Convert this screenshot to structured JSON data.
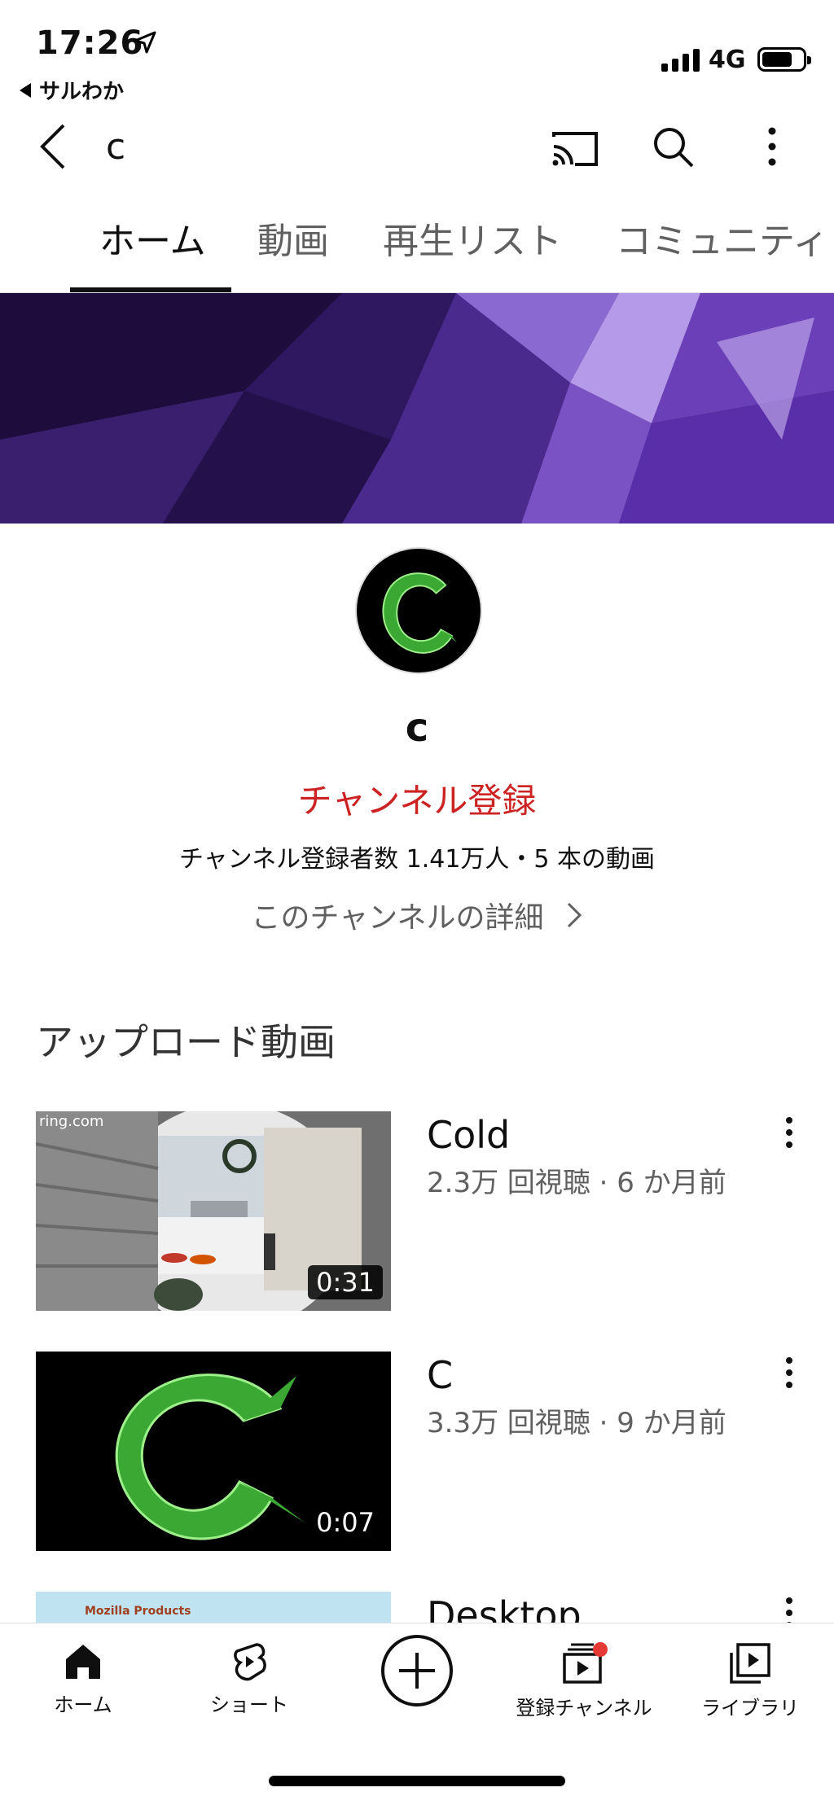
{
  "status_bar": {
    "time": "17:26",
    "back_app": "サルわか",
    "network": "4G"
  },
  "header": {
    "title": "c"
  },
  "tabs": [
    {
      "label": "ホーム",
      "active": true
    },
    {
      "label": "動画"
    },
    {
      "label": "再生リスト"
    },
    {
      "label": "コミュニティ"
    }
  ],
  "channel": {
    "name": "c",
    "subscribe_label": "チャンネル登録",
    "stats": "チャンネル登録者数 1.41万人・5 本の動画",
    "details_label": "このチャンネルの詳細",
    "subscribe_color": "#cc2222"
  },
  "uploads": {
    "section_title": "アップロード動画",
    "videos": [
      {
        "title": "Cold",
        "meta": "2.3万 回視聴 · 6 か月前",
        "duration": "0:31",
        "thumb_caption": "ring.com"
      },
      {
        "title": "C",
        "meta": "3.3万 回視聴 · 9 か月前",
        "duration": "0:07"
      },
      {
        "title": "Desktop",
        "meta": "",
        "thumb_caption": "Mozilla Products"
      }
    ]
  },
  "bottom_nav": [
    {
      "label": "ホーム",
      "icon": "home-icon"
    },
    {
      "label": "ショート",
      "icon": "shorts-icon"
    },
    {
      "label": "",
      "icon": "create-icon"
    },
    {
      "label": "登録チャンネル",
      "icon": "subscriptions-icon"
    },
    {
      "label": "ライブラリ",
      "icon": "library-icon"
    }
  ]
}
